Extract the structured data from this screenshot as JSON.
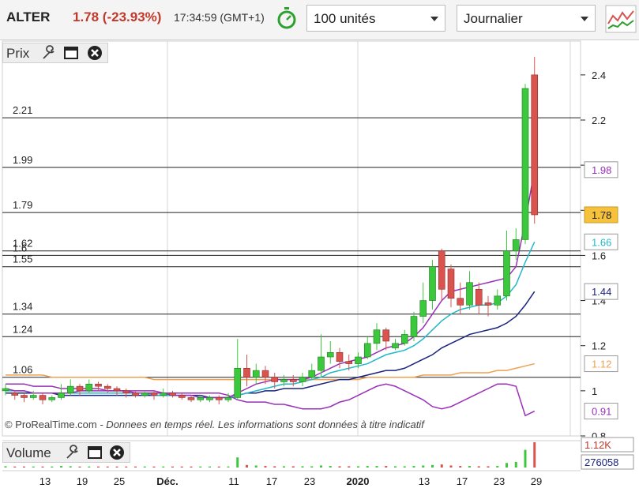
{
  "toolbar": {
    "ticker": "ALTER",
    "price_change": "1.78 (-23.93%)",
    "time": "17:34:59",
    "timezone": "(GMT+1)",
    "quantity_value": "100 unités",
    "period_value": "Journalier"
  },
  "price_panel": {
    "label": "Prix",
    "level_lines": [
      {
        "label": "2.21",
        "value": 2.21
      },
      {
        "label": "1.99",
        "value": 1.99
      },
      {
        "label": "1.79",
        "value": 1.79
      },
      {
        "label": "1.62",
        "value": 1.62
      },
      {
        "label": "1.6",
        "value": 1.6
      },
      {
        "label": "1.55",
        "value": 1.55
      },
      {
        "label": "1.34",
        "value": 1.34
      },
      {
        "label": "1.24",
        "value": 1.24
      },
      {
        "label": "1.06",
        "value": 1.06
      }
    ],
    "tag_labels": [
      {
        "text": "1.98",
        "value": 1.98,
        "color": "#9b30b8",
        "fill": "#ffffff"
      },
      {
        "text": "1.78",
        "value": 1.78,
        "color": "#222222",
        "fill": "#f6c23e"
      },
      {
        "text": "1.66",
        "value": 1.66,
        "color": "#22b8c8",
        "fill": "#ffffff"
      },
      {
        "text": "1.44",
        "value": 1.44,
        "color": "#1a237e",
        "fill": "#ffffff"
      },
      {
        "text": "1.12",
        "value": 1.12,
        "color": "#f0a050",
        "fill": "#ffffff"
      },
      {
        "text": "0.91",
        "value": 0.91,
        "color": "#9b30b8",
        "fill": "#ffffff"
      }
    ],
    "credit_site": "© ProRealTime.com",
    "credit_note": "- Donnees en temps réel. Les informations sont données à titre indicatif"
  },
  "volume_panel": {
    "label": "Volume",
    "tags": [
      "1.12K",
      "276058"
    ]
  },
  "colors": {
    "up": "#3cc83c",
    "down": "#d9534f",
    "ma_fast": "#9b30b8",
    "ma_mid": "#22b8c8",
    "ma_slow": "#1a237e",
    "ma_long": "#f0a050",
    "lower_band": "#9b30b8"
  },
  "chart_data": {
    "type": "candlestick",
    "y_ticks": [
      2.4,
      2.2,
      2.0,
      1.8,
      1.6,
      1.4,
      1.2,
      1.0,
      0.8
    ],
    "y_tick_labels": [
      "2.4",
      "2.2",
      "",
      "",
      "1.6",
      "1.4",
      "1.2",
      "1",
      "0.8"
    ],
    "ylim": [
      0.8,
      2.55
    ],
    "x_labels": [
      "13",
      "19",
      "25",
      "Déc.",
      "11",
      "17",
      "23",
      "2020",
      "13",
      "17",
      "23",
      "29"
    ],
    "candles": [
      [
        1.0,
        1.01,
        1.03,
        0.98
      ],
      [
        0.99,
        0.98,
        1.0,
        0.96
      ],
      [
        0.98,
        0.97,
        0.99,
        0.95
      ],
      [
        0.97,
        0.98,
        1.0,
        0.96
      ],
      [
        0.98,
        0.96,
        0.99,
        0.94
      ],
      [
        0.96,
        0.97,
        0.98,
        0.95
      ],
      [
        0.97,
        0.99,
        1.03,
        0.96
      ],
      [
        0.99,
        1.02,
        1.05,
        0.98
      ],
      [
        1.02,
        1.0,
        1.03,
        0.98
      ],
      [
        1.0,
        1.03,
        1.05,
        0.99
      ],
      [
        1.03,
        1.02,
        1.04,
        1.0
      ],
      [
        1.02,
        1.01,
        1.03,
        0.99
      ],
      [
        1.01,
        1.0,
        1.02,
        0.98
      ],
      [
        1.0,
        0.99,
        1.01,
        0.97
      ],
      [
        0.99,
        0.98,
        1.0,
        0.97
      ],
      [
        0.98,
        0.99,
        1.0,
        0.97
      ],
      [
        0.99,
        0.98,
        1.0,
        0.96
      ],
      [
        0.98,
        0.99,
        1.01,
        0.97
      ],
      [
        0.99,
        0.98,
        1.0,
        0.97
      ],
      [
        0.98,
        0.97,
        0.99,
        0.96
      ],
      [
        0.97,
        0.96,
        0.98,
        0.95
      ],
      [
        0.96,
        0.97,
        0.98,
        0.95
      ],
      [
        0.96,
        0.97,
        0.98,
        0.95
      ],
      [
        0.97,
        0.96,
        0.98,
        0.94
      ],
      [
        0.96,
        0.97,
        0.99,
        0.95
      ],
      [
        0.97,
        1.1,
        1.23,
        0.96
      ],
      [
        1.1,
        1.06,
        1.16,
        1.02
      ],
      [
        1.06,
        1.09,
        1.12,
        1.03
      ],
      [
        1.09,
        1.06,
        1.11,
        1.03
      ],
      [
        1.06,
        1.04,
        1.08,
        1.01
      ],
      [
        1.04,
        1.05,
        1.07,
        1.02
      ],
      [
        1.05,
        1.04,
        1.07,
        1.02
      ],
      [
        1.04,
        1.06,
        1.08,
        1.02
      ],
      [
        1.06,
        1.09,
        1.12,
        1.05
      ],
      [
        1.09,
        1.15,
        1.25,
        1.06
      ],
      [
        1.15,
        1.17,
        1.22,
        1.12
      ],
      [
        1.17,
        1.13,
        1.19,
        1.1
      ],
      [
        1.13,
        1.12,
        1.16,
        1.09
      ],
      [
        1.12,
        1.15,
        1.17,
        1.1
      ],
      [
        1.15,
        1.21,
        1.24,
        1.14
      ],
      [
        1.21,
        1.27,
        1.3,
        1.18
      ],
      [
        1.27,
        1.22,
        1.28,
        1.18
      ],
      [
        1.19,
        1.21,
        1.23,
        1.18
      ],
      [
        1.21,
        1.25,
        1.27,
        1.2
      ],
      [
        1.24,
        1.33,
        1.35,
        1.22
      ],
      [
        1.33,
        1.4,
        1.48,
        1.3
      ],
      [
        1.4,
        1.55,
        1.58,
        1.36
      ],
      [
        1.62,
        1.45,
        1.63,
        1.4
      ],
      [
        1.54,
        1.41,
        1.56,
        1.37
      ],
      [
        1.41,
        1.38,
        1.48,
        1.34
      ],
      [
        1.38,
        1.48,
        1.53,
        1.36
      ],
      [
        1.45,
        1.38,
        1.48,
        1.34
      ],
      [
        1.39,
        1.38,
        1.42,
        1.33
      ],
      [
        1.38,
        1.42,
        1.45,
        1.36
      ],
      [
        1.42,
        1.62,
        1.71,
        1.4
      ],
      [
        1.62,
        1.67,
        1.72,
        1.58
      ],
      [
        1.67,
        2.34,
        2.36,
        1.65
      ],
      [
        2.4,
        1.78,
        2.48,
        1.74
      ]
    ],
    "ma_fast": [
      1.01,
      1.0,
      1.0,
      0.99,
      0.99,
      0.99,
      0.99,
      0.99,
      1.0,
      1.0,
      1.0,
      1.0,
      1.0,
      1.0,
      0.99,
      0.99,
      0.99,
      0.99,
      0.98,
      0.98,
      0.98,
      0.97,
      0.97,
      0.97,
      0.97,
      0.99,
      1.01,
      1.03,
      1.04,
      1.05,
      1.05,
      1.05,
      1.05,
      1.06,
      1.08,
      1.1,
      1.12,
      1.13,
      1.14,
      1.15,
      1.17,
      1.19,
      1.2,
      1.21,
      1.24,
      1.28,
      1.34,
      1.4,
      1.44,
      1.45,
      1.46,
      1.47,
      1.48,
      1.49,
      1.5,
      1.55,
      1.75,
      1.98
    ],
    "ma_mid": [
      1.0,
      1.0,
      1.0,
      0.99,
      0.99,
      0.99,
      0.99,
      0.99,
      0.99,
      0.99,
      0.99,
      0.99,
      0.99,
      0.99,
      0.99,
      0.99,
      0.98,
      0.98,
      0.98,
      0.98,
      0.98,
      0.97,
      0.97,
      0.97,
      0.97,
      0.98,
      0.99,
      1.0,
      1.01,
      1.02,
      1.03,
      1.03,
      1.04,
      1.05,
      1.06,
      1.08,
      1.09,
      1.1,
      1.11,
      1.12,
      1.14,
      1.16,
      1.17,
      1.18,
      1.2,
      1.23,
      1.27,
      1.31,
      1.34,
      1.36,
      1.37,
      1.38,
      1.38,
      1.39,
      1.42,
      1.47,
      1.57,
      1.66
    ],
    "ma_slow": [
      0.99,
      0.99,
      0.99,
      0.99,
      0.99,
      0.99,
      0.98,
      0.98,
      0.98,
      0.98,
      0.98,
      0.98,
      0.98,
      0.98,
      0.98,
      0.98,
      0.98,
      0.98,
      0.98,
      0.98,
      0.98,
      0.98,
      0.97,
      0.97,
      0.97,
      0.98,
      0.99,
      0.99,
      1.0,
      1.0,
      1.01,
      1.01,
      1.01,
      1.02,
      1.03,
      1.04,
      1.05,
      1.05,
      1.06,
      1.07,
      1.08,
      1.09,
      1.09,
      1.1,
      1.12,
      1.14,
      1.16,
      1.19,
      1.21,
      1.23,
      1.25,
      1.26,
      1.27,
      1.28,
      1.3,
      1.33,
      1.38,
      1.44
    ],
    "ma_long": [
      1.07,
      1.07,
      1.07,
      1.07,
      1.07,
      1.06,
      1.06,
      1.06,
      1.06,
      1.06,
      1.06,
      1.06,
      1.06,
      1.06,
      1.06,
      1.06,
      1.05,
      1.05,
      1.05,
      1.05,
      1.05,
      1.05,
      1.05,
      1.05,
      1.05,
      1.05,
      1.05,
      1.05,
      1.05,
      1.05,
      1.05,
      1.05,
      1.05,
      1.05,
      1.05,
      1.05,
      1.05,
      1.05,
      1.05,
      1.06,
      1.06,
      1.06,
      1.06,
      1.06,
      1.06,
      1.07,
      1.07,
      1.07,
      1.07,
      1.08,
      1.08,
      1.08,
      1.08,
      1.09,
      1.09,
      1.1,
      1.11,
      1.12
    ],
    "lower_band": [
      1.03,
      1.03,
      1.03,
      1.02,
      1.02,
      1.02,
      1.01,
      1.01,
      1.01,
      1.01,
      1.01,
      1.0,
      1.0,
      1.0,
      1.0,
      1.0,
      1.0,
      0.99,
      0.99,
      0.99,
      0.99,
      0.99,
      0.99,
      0.99,
      0.98,
      0.96,
      0.95,
      0.95,
      0.95,
      0.94,
      0.94,
      0.93,
      0.92,
      0.92,
      0.92,
      0.93,
      0.95,
      0.96,
      0.98,
      1.0,
      1.02,
      1.03,
      1.02,
      1.0,
      0.98,
      0.96,
      0.93,
      0.92,
      0.93,
      0.95,
      0.97,
      0.99,
      1.01,
      1.03,
      1.03,
      1.02,
      0.89,
      0.91
    ],
    "volume": [
      0.05,
      0.04,
      0.04,
      0.04,
      0.04,
      0.04,
      0.06,
      0.05,
      0.04,
      0.04,
      0.04,
      0.04,
      0.04,
      0.04,
      0.04,
      0.04,
      0.04,
      0.04,
      0.04,
      0.04,
      0.04,
      0.04,
      0.04,
      0.04,
      0.04,
      0.4,
      0.1,
      0.08,
      0.06,
      0.05,
      0.05,
      0.05,
      0.05,
      0.05,
      0.08,
      0.06,
      0.05,
      0.05,
      0.05,
      0.06,
      0.06,
      0.06,
      0.05,
      0.05,
      0.06,
      0.08,
      0.1,
      0.12,
      0.08,
      0.06,
      0.06,
      0.05,
      0.05,
      0.06,
      0.18,
      0.22,
      0.7,
      1.0
    ]
  }
}
